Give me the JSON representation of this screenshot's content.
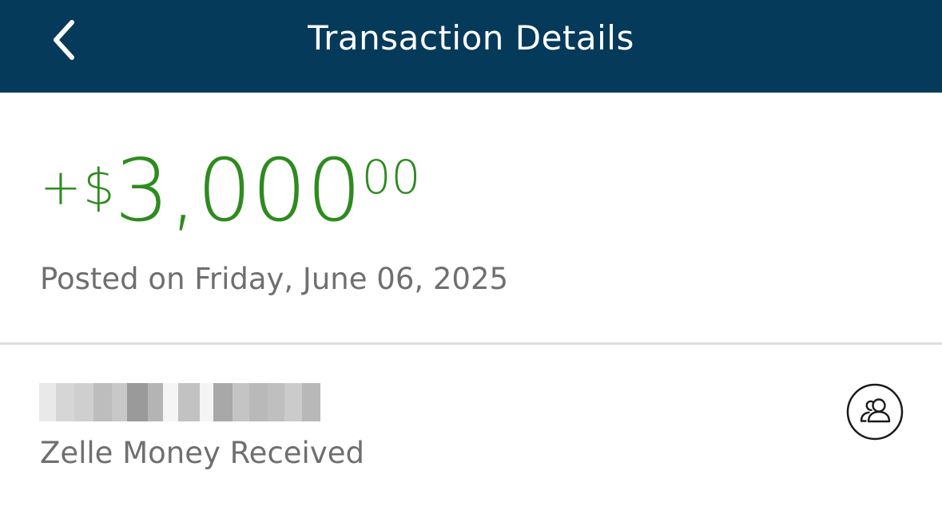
{
  "header": {
    "title": "Transaction Details",
    "background_color": "#053a5b",
    "back_icon": "chevron-left-icon"
  },
  "transaction": {
    "sign": "+",
    "currency": "$",
    "amount_whole": "3,000",
    "amount_cents": "00",
    "amount_color": "#2e8b1f",
    "posted_text": "Posted on Friday, June 06, 2025",
    "description": "Zelle Money Received",
    "contact_icon": "contacts-icon"
  }
}
